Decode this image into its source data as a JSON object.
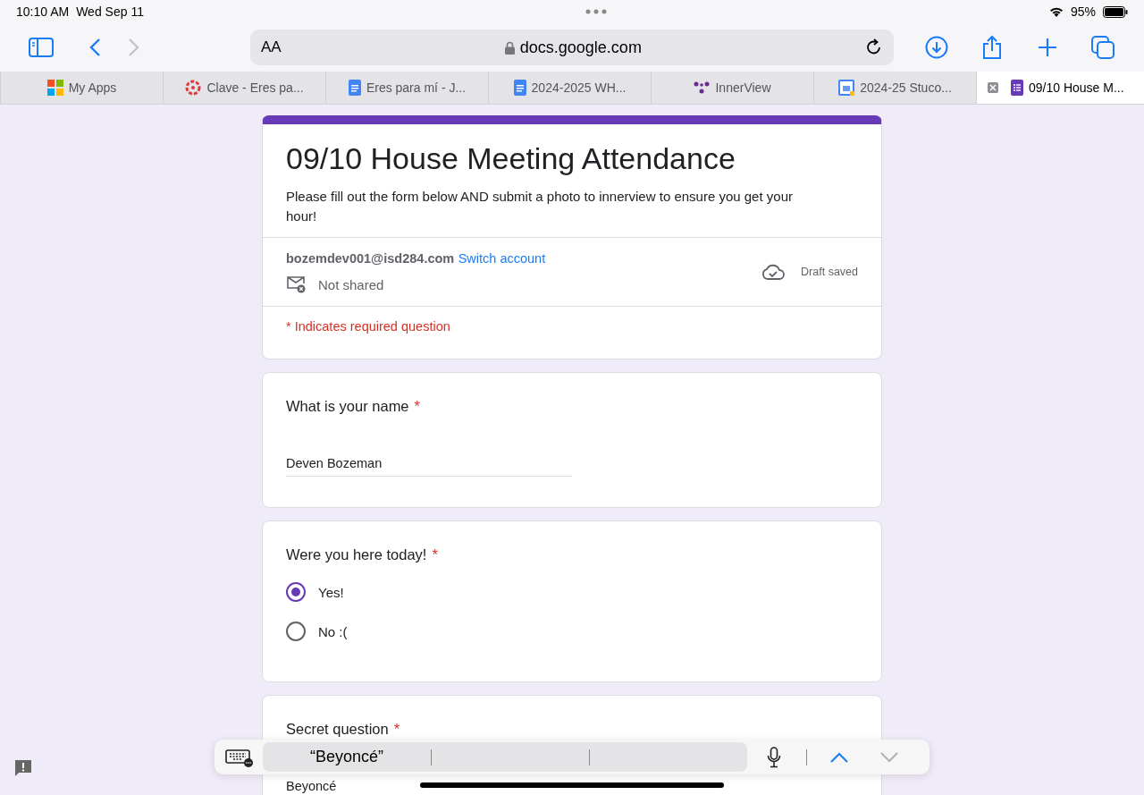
{
  "status_bar": {
    "time": "10:10 AM",
    "date": "Wed Sep 11",
    "battery": "95%"
  },
  "address_bar": {
    "text_size": "AA",
    "url": "docs.google.com"
  },
  "tabs": [
    {
      "label": "My Apps",
      "selected": false
    },
    {
      "label": "Clave - Eres pa...",
      "selected": false
    },
    {
      "label": "Eres para mí - J...",
      "selected": false
    },
    {
      "label": "2024-2025 WH...",
      "selected": false
    },
    {
      "label": "InnerView",
      "selected": false
    },
    {
      "label": "2024-25 Stuco...",
      "selected": false
    },
    {
      "label": "09/10 House M...",
      "selected": true
    }
  ],
  "form": {
    "title": "09/10 House Meeting Attendance",
    "description": "Please fill out the form below AND submit a photo to innerview to ensure you get your hour!",
    "account": "bozemdev001@isd284.com",
    "switch_account": "Switch account",
    "sharing": "Not shared",
    "draft_status": "Draft saved",
    "required_note": "* Indicates required question",
    "required_mark": "*",
    "questions": [
      {
        "kind": "text",
        "title": "What is your name",
        "required": true,
        "value": "Deven Bozeman",
        "focused": false
      },
      {
        "kind": "radio",
        "title": "Were you here today!",
        "required": true,
        "options": [
          {
            "label": "Yes!",
            "selected": true
          },
          {
            "label": "No :(",
            "selected": false
          }
        ]
      },
      {
        "kind": "text",
        "title": "Secret question",
        "required": true,
        "value": "Beyoncé",
        "focused": true
      }
    ]
  },
  "keyboard_bar": {
    "suggestions": [
      "“Beyoncé”"
    ]
  }
}
